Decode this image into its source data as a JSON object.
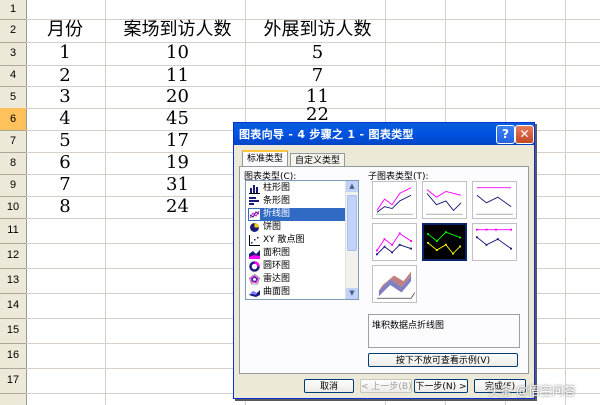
{
  "sheet": {
    "row_numbers": [
      "1",
      "2",
      "3",
      "4",
      "5",
      "6",
      "7",
      "8",
      "9",
      "10",
      "11",
      "12",
      "13",
      "14",
      "15",
      "16",
      "17"
    ],
    "headers": {
      "month": "月份",
      "venue": "案场到访人数",
      "expo": "外展到访人数"
    },
    "months": [
      "1",
      "2",
      "3",
      "4",
      "5",
      "6",
      "7",
      "8"
    ],
    "venue_visits": [
      "10",
      "11",
      "20",
      "45",
      "17",
      "19",
      "31",
      "24"
    ],
    "expo_visits": [
      "5",
      "7",
      "11",
      "22"
    ]
  },
  "dialog": {
    "title": "图表向导 - 4 步骤之 1 - 图表类型",
    "help_glyph": "?",
    "close_glyph": "✕",
    "tabs": {
      "standard": "标准类型",
      "custom": "自定义类型"
    },
    "chart_type_label": "图表类型(C):",
    "subtype_label": "子图表类型(T):",
    "chart_types": [
      "柱形图",
      "条形图",
      "折线图",
      "饼图",
      "XY 散点图",
      "面积图",
      "圆环图",
      "雷达图",
      "曲面图"
    ],
    "selected_type": "折线图",
    "subtype_description": "堆积数据点折线图",
    "preview_button": "按下不放可查看示例(V)",
    "buttons": {
      "cancel": "取消",
      "back": "< 上一步(B)",
      "next": "下一步(N) >",
      "finish": "完成(F)"
    }
  },
  "watermark": "头条 @悟空问答",
  "colors": {
    "selection": "#316ac5",
    "titlebar": "#0054e3",
    "active_row": "#ffc15c",
    "series_magenta": "#ff00ff",
    "series_navy": "#1a1a7a"
  }
}
